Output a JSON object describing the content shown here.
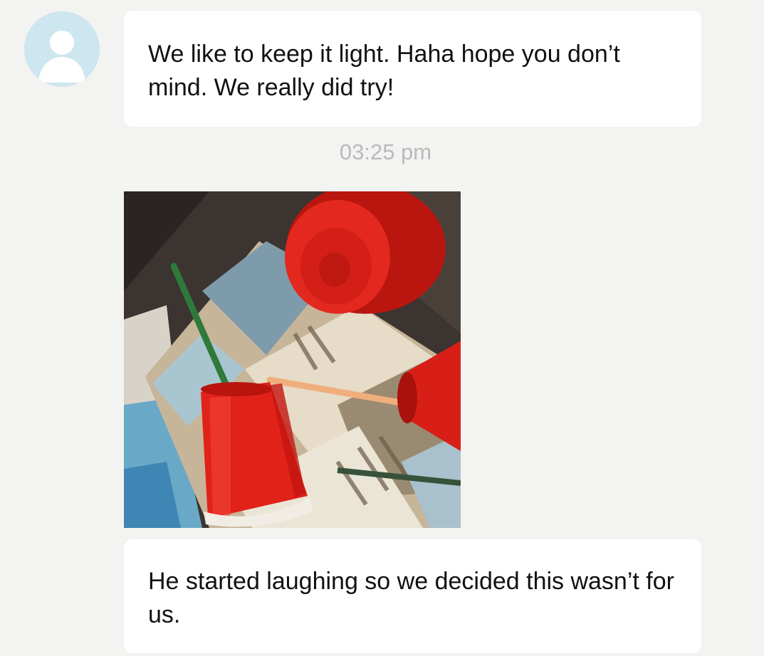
{
  "conversation": {
    "messages": [
      {
        "type": "text",
        "sender_avatar": "default-person-icon",
        "text": "We like to keep it light. Haha hope you don’t mind. We really did try!"
      },
      {
        "type": "timestamp",
        "text": "03:25 pm"
      },
      {
        "type": "image",
        "content_icon": "photo-red-cups-straws-on-sign"
      },
      {
        "type": "text",
        "text": "He started laughing so we decided this wasn’t for us."
      }
    ]
  },
  "colors": {
    "background": "#f3f3f1",
    "bubble": "#ffffff",
    "avatar_bg": "#cde6ef",
    "avatar_fg": "#ffffff",
    "timestamp": "#b9b9b9",
    "cup_red": "#e0231d"
  }
}
